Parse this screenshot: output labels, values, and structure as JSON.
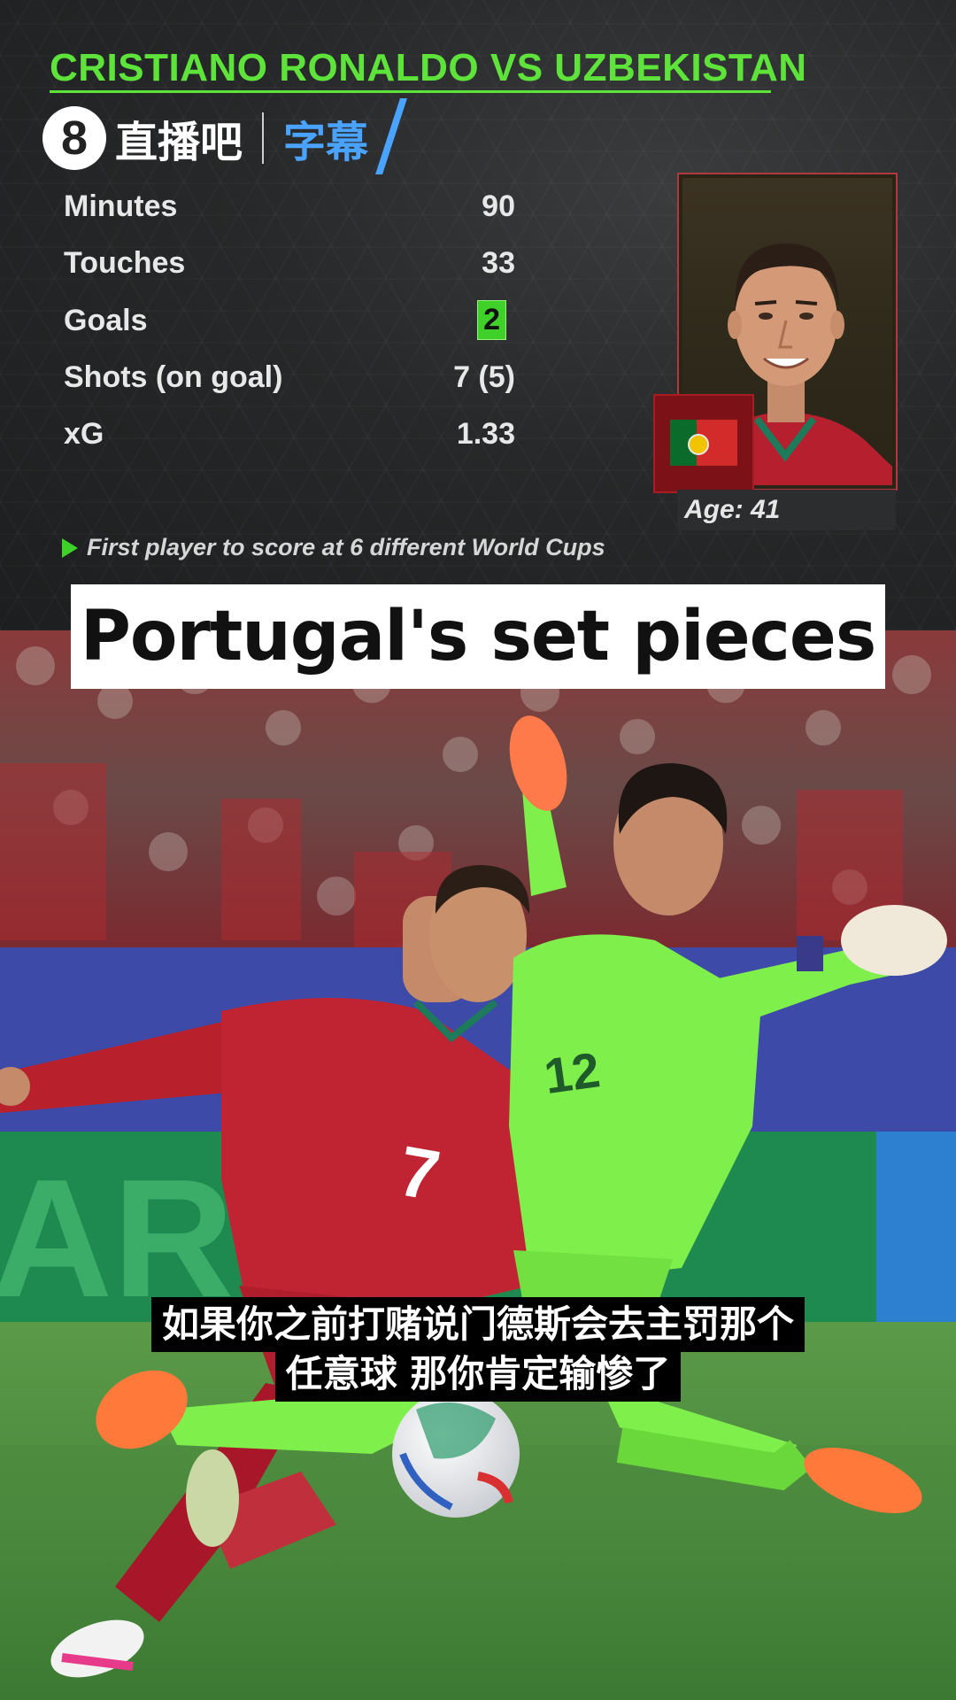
{
  "header": {
    "title": "CRISTIANO RONALDO VS UZBEKISTAN",
    "brand_logo": "8",
    "brand_name": "直播吧",
    "brand_sub": "字幕"
  },
  "stats": [
    {
      "label": "Minutes",
      "value": "90"
    },
    {
      "label": "Touches",
      "value": "33"
    },
    {
      "label": "Goals",
      "value": "2"
    },
    {
      "label": "Shots (on goal)",
      "value": "7 (5)"
    },
    {
      "label": "xG",
      "value": "1.33"
    }
  ],
  "note": "First player to score at 6 different World Cups",
  "player_card": {
    "age_label": "Age: 41",
    "flag_icon": "portugal-flag-icon"
  },
  "banner": {
    "title": "Portugal's set pieces"
  },
  "subtitles": {
    "line1": "如果你之前打赌说门德斯会去主罚那个",
    "line2": "任意球 那你肯定输惨了"
  },
  "colors": {
    "accent_green": "#5ee33a",
    "brand_blue": "#4aa3ff",
    "card_border_red": "#b2383d",
    "portugal_red": "#d32a2a",
    "goalkeeper_kit": "#7fff4a"
  }
}
